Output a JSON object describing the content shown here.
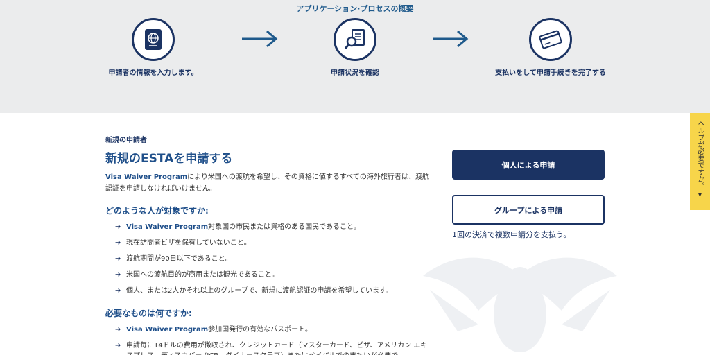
{
  "process": {
    "title": "アプリケーション·プロセスの概要",
    "steps": [
      {
        "label": "申請者の情報を入力します。",
        "icon": "passport-icon"
      },
      {
        "label": "申請状況を確認",
        "icon": "document-search-icon"
      },
      {
        "label": "支払いをして申請手続きを完了する",
        "icon": "credit-card-icon"
      }
    ]
  },
  "main": {
    "kicker": "新規の申請者",
    "headline": "新規のESTAを申請する",
    "intro": {
      "highlight": "Visa Waiver Program",
      "rest": "により米国への渡航を希望し、その資格に値するすべての海外旅行者は、渡航認証を申請しなければいけません。"
    },
    "who": {
      "heading": "どのような人が対象ですか:",
      "items": [
        {
          "highlight": "Visa Waiver Program",
          "text": "対象国の市民または資格のある国民であること。"
        },
        {
          "highlight": "",
          "text": "現在訪問者ビザを保有していないこと。"
        },
        {
          "highlight": "",
          "text": "渡航期間が90日以下であること。"
        },
        {
          "highlight": "",
          "text": "米国への渡航目的が商用または観光であること。"
        },
        {
          "highlight": "",
          "text": "個人、または2人かそれ以上のグループで、新規に渡航認証の申請を希望しています。"
        }
      ]
    },
    "needs": {
      "heading": "必要なものは何ですか:",
      "items": [
        {
          "highlight": "Visa Waiver Program",
          "text": "参加国発行の有効なパスポート。"
        },
        {
          "highlight": "",
          "text": "申請毎に14ドルの費用が徴収され、クレジットカード（マスターカード、ビザ、アメリカン エキスプレス、ディスカバー (JCB、ダイナースクラブ）またはペイパルでの支払いが必要で"
        }
      ]
    }
  },
  "actions": {
    "individual": "個人による申請",
    "group": "グループによる申請",
    "group_note": "1回の決済で複数申請分を支払う。"
  },
  "help": {
    "label": "ヘルプが必要ですか。",
    "caret": "▼"
  },
  "colors": {
    "navy": "#1b3363",
    "blue": "#1f4f8a",
    "strip": "#ebeced",
    "help": "#f7d54a"
  }
}
